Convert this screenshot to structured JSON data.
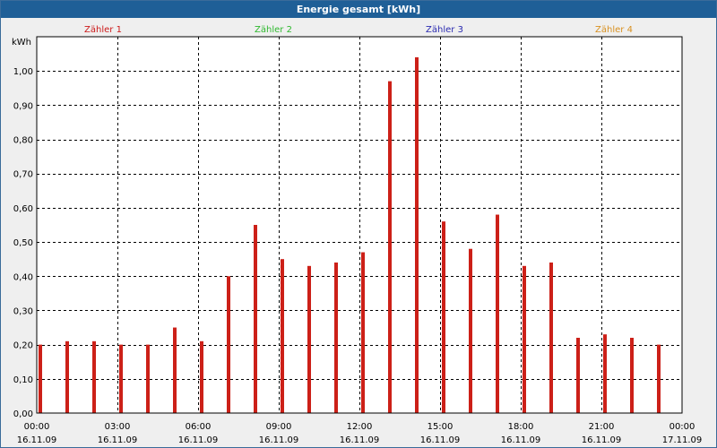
{
  "window": {
    "title": "Energie gesamt [kWh]"
  },
  "colors": {
    "titlebar": "#1f5f97",
    "bar": "#cc2018",
    "zaehler1": "#cc1a1a",
    "zaehler2": "#2eb82e",
    "zaehler3": "#2a2ab0",
    "zaehler4": "#d89020"
  },
  "chart_data": {
    "type": "bar",
    "title": "Energie gesamt [kWh]",
    "ylabel": "kWh",
    "ylim": [
      0,
      1.1
    ],
    "yticks": [
      "0,00",
      "0,10",
      "0,20",
      "0,30",
      "0,40",
      "0,50",
      "0,60",
      "0,70",
      "0,80",
      "0,90",
      "1,00"
    ],
    "xticks": [
      {
        "time": "00:00",
        "date": "16.11.09"
      },
      {
        "time": "03:00",
        "date": "16.11.09"
      },
      {
        "time": "06:00",
        "date": "16.11.09"
      },
      {
        "time": "09:00",
        "date": "16.11.09"
      },
      {
        "time": "12:00",
        "date": "16.11.09"
      },
      {
        "time": "15:00",
        "date": "16.11.09"
      },
      {
        "time": "18:00",
        "date": "16.11.09"
      },
      {
        "time": "21:00",
        "date": "16.11.09"
      },
      {
        "time": "00:00",
        "date": "17.11.09"
      }
    ],
    "legend": [
      {
        "label": "Zähler 1",
        "color": "#cc1a1a"
      },
      {
        "label": "Zähler 2",
        "color": "#2eb82e"
      },
      {
        "label": "Zähler 3",
        "color": "#2a2ab0"
      },
      {
        "label": "Zähler 4",
        "color": "#d89020"
      }
    ],
    "categories": [
      "00:00",
      "01:00",
      "02:00",
      "03:00",
      "04:00",
      "05:00",
      "06:00",
      "07:00",
      "08:00",
      "09:00",
      "10:00",
      "11:00",
      "12:00",
      "13:00",
      "14:00",
      "15:00",
      "16:00",
      "17:00",
      "18:00",
      "19:00",
      "20:00",
      "21:00",
      "22:00",
      "23:00"
    ],
    "values": [
      0.2,
      0.21,
      0.21,
      0.2,
      0.2,
      0.25,
      0.21,
      0.4,
      0.55,
      0.45,
      0.43,
      0.44,
      0.47,
      0.97,
      1.04,
      0.56,
      0.48,
      0.58,
      0.43,
      0.44,
      0.22,
      0.23,
      0.22,
      0.2
    ],
    "grid": true
  }
}
